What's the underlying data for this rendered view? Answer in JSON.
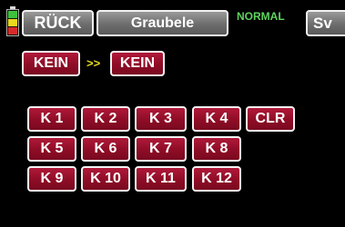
{
  "header": {
    "back_label": "RÜCK",
    "model_name": "Graubele",
    "mode": "NORMAL",
    "next_label": "Sv",
    "battery_icon": "battery-icon",
    "battery_colors": [
      "#3cc23c",
      "#e8d81e",
      "#d82a2a"
    ]
  },
  "switch_row": {
    "from_label": "KEIN",
    "arrow_label": ">>",
    "to_label": "KEIN"
  },
  "channels": {
    "k1": "K 1",
    "k2": "K 2",
    "k3": "K 3",
    "k4": "K 4",
    "clr": "CLR",
    "k5": "K 5",
    "k6": "K 6",
    "k7": "K 7",
    "k8": "K 8",
    "k9": "K 9",
    "k10": "K 10",
    "k11": "K 11",
    "k12": "K 12"
  },
  "colors": {
    "button_red": "#8e0c26",
    "button_grey": "#6d6d6d",
    "mode_green": "#5fd35f",
    "arrow_yellow": "#e8d81e"
  }
}
